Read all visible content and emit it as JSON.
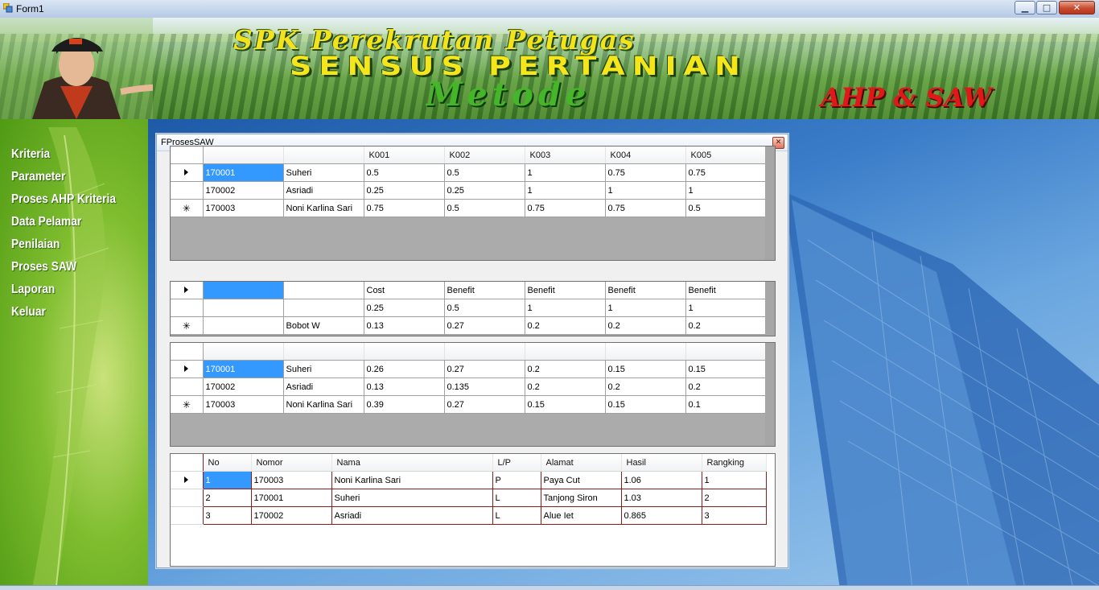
{
  "window": {
    "title": "Form1",
    "min_glyph": "▁",
    "max_glyph": "□",
    "close_glyph": "✕"
  },
  "banner": {
    "line1": "SPK Perekrutan Petugas",
    "line2": "SENSUS PERTANIAN",
    "line3": "Metode",
    "line3b": "AHP & SAW"
  },
  "menu": [
    "Kriteria",
    "Parameter",
    "Proses AHP Kriteria",
    "Data Pelamar",
    "Penilaian",
    "Proses SAW",
    "Laporan",
    "Keluar"
  ],
  "child": {
    "title": "FProsesSAW",
    "close_glyph": "✕"
  },
  "grid1": {
    "headers": [
      "",
      "",
      "K001",
      "K002",
      "K003",
      "K004",
      "K005"
    ],
    "rows": [
      {
        "marker": "arrow",
        "cells": [
          "170001",
          "Suheri",
          "0.5",
          "0.5",
          "1",
          "0.75",
          "0.75"
        ]
      },
      {
        "marker": "",
        "cells": [
          "170002",
          "Asriadi",
          "0.25",
          "0.25",
          "1",
          "1",
          "1"
        ]
      },
      {
        "marker": "star",
        "cells": [
          "170003",
          "Noni Karlina Sari",
          "0.75",
          "0.5",
          "0.75",
          "0.75",
          "0.5"
        ]
      }
    ]
  },
  "grid2": {
    "rows": [
      {
        "marker": "arrow",
        "cells": [
          "",
          "",
          "Cost",
          "Benefit",
          "Benefit",
          "Benefit",
          "Benefit"
        ]
      },
      {
        "marker": "",
        "cells": [
          "",
          "",
          "0.25",
          "0.5",
          "1",
          "1",
          "1"
        ]
      },
      {
        "marker": "star",
        "cells": [
          "",
          "Bobot W",
          "0.13",
          "0.27",
          "0.2",
          "0.2",
          "0.2"
        ]
      }
    ]
  },
  "grid3": {
    "headers": [
      "",
      "",
      "",
      "",
      "",
      "",
      ""
    ],
    "rows": [
      {
        "marker": "arrow",
        "cells": [
          "170001",
          "Suheri",
          "0.26",
          "0.27",
          "0.2",
          "0.15",
          "0.15"
        ]
      },
      {
        "marker": "",
        "cells": [
          "170002",
          "Asriadi",
          "0.13",
          "0.135",
          "0.2",
          "0.2",
          "0.2"
        ]
      },
      {
        "marker": "star",
        "cells": [
          "170003",
          "Noni Karlina Sari",
          "0.39",
          "0.27",
          "0.15",
          "0.15",
          "0.1"
        ]
      }
    ]
  },
  "grid4": {
    "headers": [
      "No",
      "Nomor",
      "Nama",
      "L/P",
      "Alamat",
      "Hasil",
      "Rangking"
    ],
    "rows": [
      {
        "marker": "arrow",
        "cells": [
          "1",
          "170003",
          "Noni Karlina Sari",
          "P",
          "Paya Cut",
          "1.06",
          "1"
        ]
      },
      {
        "marker": "",
        "cells": [
          "2",
          "170001",
          "Suheri",
          "L",
          "Tanjong Siron",
          "1.03",
          "2"
        ]
      },
      {
        "marker": "",
        "cells": [
          "3",
          "170002",
          "Asriadi",
          "L",
          "Alue Iet",
          "0.865",
          "3"
        ]
      }
    ]
  },
  "colors": {
    "selection": "#3399ff",
    "grid_bg": "#ababab",
    "menu_text": "#ffffff"
  }
}
